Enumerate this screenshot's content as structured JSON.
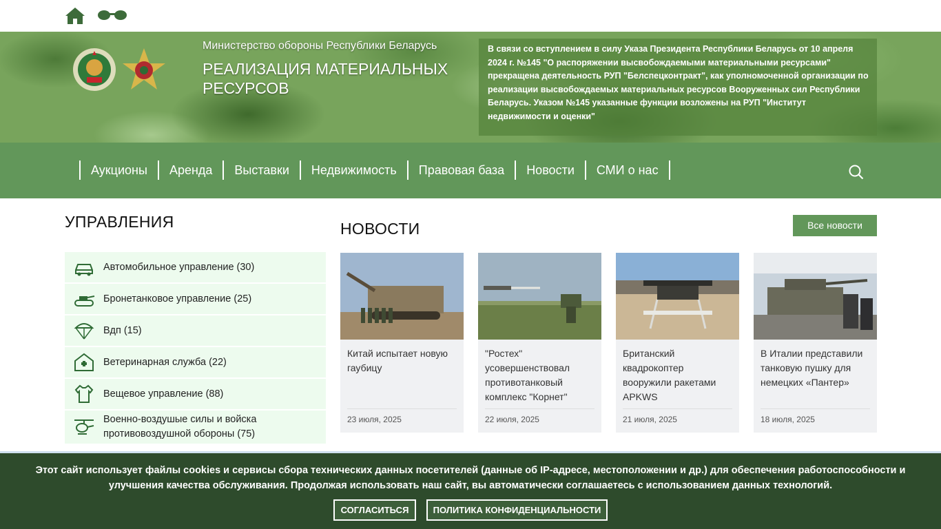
{
  "banner": {
    "ministry": "Министерство обороны Республики Беларусь",
    "title": "РЕАЛИЗАЦИЯ МАТЕРИАЛЬНЫХ РЕСУРСОВ",
    "notice": "В связи со вступлением в силу Указа Президента Республики Беларусь от 10 апреля 2024 г. №145 \"О распоряжении высвобождаемыми материальными ресурсами\" прекращена деятельность РУП \"Белспецконтракт\", как уполномоченной организации по реализации высвобождаемых материальных ресурсов Вооруженных сил Республики Беларусь. Указом №145 указанные функции возложены на РУП \"Институт недвижимости и оценки\""
  },
  "nav": {
    "items": [
      "Аукционы",
      "Аренда",
      "Выставки",
      "Недвижимость",
      "Правовая база",
      "Новости",
      "СМИ о нас"
    ]
  },
  "departments": {
    "title": "УПРАВЛЕНИЯ",
    "items": [
      {
        "label": "Автомобильное управление (30)",
        "icon": "car-icon"
      },
      {
        "label": "Бронетанковое управление (25)",
        "icon": "tank-icon"
      },
      {
        "label": "Вдп (15)",
        "icon": "parachute-icon"
      },
      {
        "label": "Ветеринарная служба (22)",
        "icon": "veterinary-icon"
      },
      {
        "label": "Вещевое управление (88)",
        "icon": "clothing-icon"
      },
      {
        "label": "Военно-воздушые силы и войска противовоздушной обороны (75)",
        "icon": "helicopter-icon"
      }
    ]
  },
  "news": {
    "title": "НОВОСТИ",
    "all_label": "Все новости",
    "items": [
      {
        "title": "Китай испытает новую гаубицу",
        "date": "23 июля, 2025"
      },
      {
        "title": "\"Ростех\" усовершенствовал противотанковый комплекс \"Корнет\"",
        "date": "22 июля, 2025"
      },
      {
        "title": "Британский квадрокоптер вооружили ракетами APKWS",
        "date": "21 июля, 2025"
      },
      {
        "title": "В Италии представили танковую пушку для немецких «Пантер»",
        "date": "18 июля, 2025"
      }
    ]
  },
  "cookie": {
    "text": "Этот сайт использует файлы cookies и сервисы сбора технических данных посетителей (данные об IP-адресе, местоположении и др.) для обеспечения работоспособности и улучшения качества обслуживания. Продолжая использовать наш сайт, вы автоматически соглашаетесь с использованием данных технологий.",
    "agree": "СОГЛАСИТЬСЯ",
    "policy": "ПОЛИТИКА КОНФИДЕНЦИАЛЬНОСТИ"
  },
  "colors": {
    "accent": "#62975a",
    "cookie_bg": "#2e4b2c",
    "item_bg": "#edfbee"
  }
}
